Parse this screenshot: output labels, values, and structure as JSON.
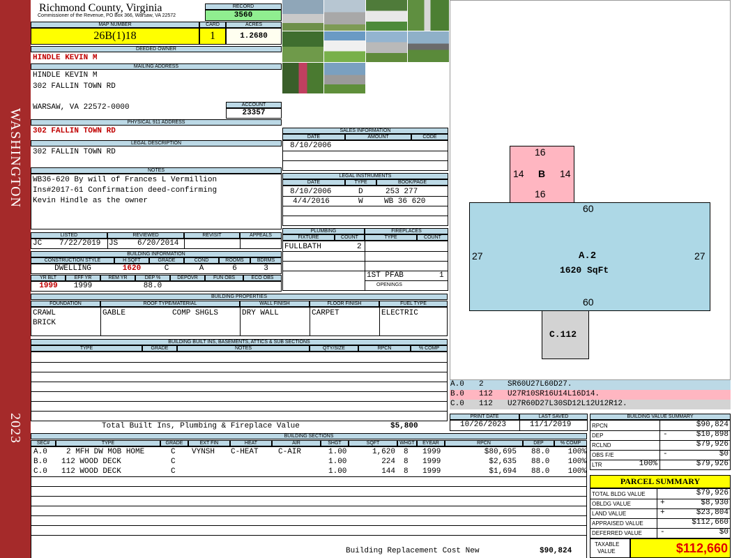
{
  "sidebar": {
    "top": "WASHINGTON",
    "bottom": "2023"
  },
  "header": {
    "county": "Richmond County, Virginia",
    "address": "Commissioner of the Revenue, PO Box 366, Warsaw, VA 22572",
    "record_label": "RECORD",
    "record": "3560",
    "map_label": "MAP NUMBER",
    "map_number": "26B(1)18",
    "card_label": "CARD",
    "card": "1",
    "acres_label": "ACRES",
    "acres": "1.2680"
  },
  "owner": {
    "deeded_label": "DEEDED OWNER",
    "deeded": "HINDLE KEVIN M",
    "mailing_label": "MAILING ADDRESS",
    "mailing_1": "HINDLE KEVIN M",
    "mailing_2": "302 FALLIN TOWN RD",
    "mailing_3": "WARSAW, VA 22572-0000",
    "account_label": "ACCOUNT",
    "account": "23357",
    "physical_label": "PHYSICAL 911 ADDRESS",
    "physical": "302 FALLIN TOWN RD",
    "legal_label": "LEGAL DESCRIPTION",
    "legal": "302 FALLIN TOWN RD",
    "notes_label": "NOTES",
    "notes": [
      "WB36-620 By will of Frances L Vermillion",
      "Ins#2017-61 Confirmation deed-confirming",
      "Kevin Hindle as the owner"
    ]
  },
  "sales": {
    "title": "SALES INFORMATION",
    "cols": [
      "DATE",
      "AMOUNT",
      "CODE"
    ],
    "rows": [
      {
        "date": "8/10/2006"
      }
    ]
  },
  "legal_instruments": {
    "title": "LEGAL INSTRUMENTS",
    "cols": [
      "DATE",
      "TYPE",
      "BOOK/PAGE"
    ],
    "rows": [
      {
        "date": "8/10/2006",
        "type": "D",
        "book": "253 277"
      },
      {
        "date": "4/4/2016",
        "type": "W",
        "book": "WB 36 620"
      }
    ]
  },
  "listed": {
    "listed_label": "LISTED",
    "reviewed_label": "REVIEWED",
    "revisit_label": "REVISIT",
    "appeals_label": "APPEALS",
    "listed_by": "JC",
    "listed_date": "7/22/2019",
    "reviewed_by": "JS",
    "reviewed_date": "6/20/2014"
  },
  "building_info": {
    "title": "BUILDING INFORMATION",
    "cols1": [
      "CONSTRUCTION STYLE",
      "H SQFT",
      "GRADE",
      "COND",
      "ROOMS",
      "BDRMS"
    ],
    "style": "DWELLING",
    "hsqft": "1620",
    "grade": "C",
    "cond": "A",
    "rooms": "6",
    "bdrms": "3",
    "cols2": [
      "YR BLT",
      "EFF YR",
      "REM YR",
      "DEP %",
      "DEPOVR",
      "FUN OBS",
      "ECO OBS"
    ],
    "yr_blt": "1999",
    "eff_yr": "1999",
    "dep": "88.0"
  },
  "plumbing": {
    "title": "PLUMBING",
    "cols": [
      "FIXTURE",
      "COUNT"
    ],
    "rows": [
      {
        "fixture": "FULLBATH",
        "count": "2"
      }
    ]
  },
  "fireplaces": {
    "title": "FIREPLACES",
    "cols": [
      "TYPE",
      "COUNT"
    ],
    "rows": [
      {
        "type": "1ST PFAB",
        "count": "1"
      }
    ],
    "openings_label": "OPENINGS"
  },
  "properties": {
    "title": "BUILDING PROPERTIES",
    "cols": [
      "FOUNDATION",
      "ROOF TYPE/MATERIAL",
      "WALL FINISH",
      "FLOOR FINISH",
      "FUEL TYPE"
    ],
    "foundation_1": "CRAWL",
    "foundation_2": "BRICK",
    "roof_type": "GABLE",
    "roof_mat": "COMP SHGLS",
    "wall": "DRY WALL",
    "floor": "CARPET",
    "fuel": "ELECTRIC"
  },
  "builtins": {
    "title": "BUILDING BUILT INS, BASEMENTS, ATTICS & SUB SECTIONS",
    "cols": [
      "TYPE",
      "GRADE",
      "NOTES",
      "QTY/SIZE",
      "RPCN",
      "% COMP"
    ],
    "total_label": "Total Built Ins, Plumbing & Fireplace Value",
    "total": "$5,800"
  },
  "sections": {
    "title": "BUILDING SECTIONS",
    "cols": [
      "SEC#",
      "TYPE",
      "GRADE",
      "EXT FIN",
      "HEAT",
      "AIR",
      "SHGT",
      "SQFT",
      "WHGT",
      "EYEAR",
      "RPCN",
      "DEP",
      "% COMP"
    ],
    "rows": [
      {
        "sec": "A.0",
        "type": "2 MFH DW MOB HOME",
        "grade": "C",
        "ext": "VYNSH",
        "heat": "C-HEAT",
        "air": "C-AIR",
        "shgt": "1.00",
        "sqft": "1,620",
        "whgt": "8",
        "eyear": "1999",
        "rpcn": "$80,695",
        "dep": "88.0",
        "comp": "100%"
      },
      {
        "sec": "B.0",
        "type": "112 WOOD DECK",
        "grade": "C",
        "ext": "",
        "heat": "",
        "air": "",
        "shgt": "1.00",
        "sqft": "224",
        "whgt": "8",
        "eyear": "1999",
        "rpcn": "$2,635",
        "dep": "88.0",
        "comp": "100%"
      },
      {
        "sec": "C.0",
        "type": "112 WOOD DECK",
        "grade": "C",
        "ext": "",
        "heat": "",
        "air": "",
        "shgt": "1.00",
        "sqft": "144",
        "whgt": "8",
        "eyear": "1999",
        "rpcn": "$1,694",
        "dep": "88.0",
        "comp": "100%"
      }
    ],
    "replacement_label": "Building Replacement Cost New",
    "replacement": "$90,824"
  },
  "sketch": {
    "b_label": "B",
    "b_top": "16",
    "b_left": "14",
    "b_right": "14",
    "b_bottom": "16",
    "a_label": "A.2",
    "a_area": "1620 SqFt",
    "a_top": "60",
    "a_left": "27",
    "a_right": "27",
    "a_bottom": "60",
    "c_label": "C.112"
  },
  "vectors": [
    {
      "code": "A.0",
      "num": "2",
      "vec": "SR60U27L60D27.",
      "color": "#bcd9e6"
    },
    {
      "code": "B.0",
      "num": "112",
      "vec": "U27R10SR16U14L16D14.",
      "color": "#ffb6c1"
    },
    {
      "code": "C.0",
      "num": "112",
      "vec": "U27R60D27L30SD12L12U12R12.",
      "color": "#d3d3d3"
    }
  ],
  "dates": {
    "print_label": "PRINT DATE",
    "print": "10/26/2023",
    "saved_label": "LAST SAVED",
    "saved": "11/1/2019"
  },
  "value_summary": {
    "title": "BUILDING VALUE SUMMARY",
    "rpcn_label": "RPCN",
    "rpcn": "$90,824",
    "dep_label": "DEP",
    "dep_sign": "-",
    "dep": "$10,898",
    "rclnd_label": "RCLND",
    "rclnd": "$79,926",
    "obs_label": "OBS F/E",
    "obs_sign": "-",
    "obs": "$0",
    "ltr_label": "LTR",
    "ltr_pct": "100%",
    "ltr": "$79,926"
  },
  "parcel": {
    "title": "PARCEL SUMMARY",
    "rows": [
      {
        "label": "TOTAL BLDG VALUE",
        "sign": "",
        "value": "$79,926"
      },
      {
        "label": "OBLDG VALUE",
        "sign": "+",
        "value": "$8,930"
      },
      {
        "label": "LAND VALUE",
        "sign": "+",
        "value": "$23,804"
      },
      {
        "label": "APPRAISED VALUE",
        "sign": "",
        "value": "$112,660"
      },
      {
        "label": "DEFERRED VALUE",
        "sign": "-",
        "value": "$0"
      }
    ],
    "taxable_label_1": "TAXABLE",
    "taxable_label_2": "VALUE",
    "taxable": "$112,660"
  }
}
